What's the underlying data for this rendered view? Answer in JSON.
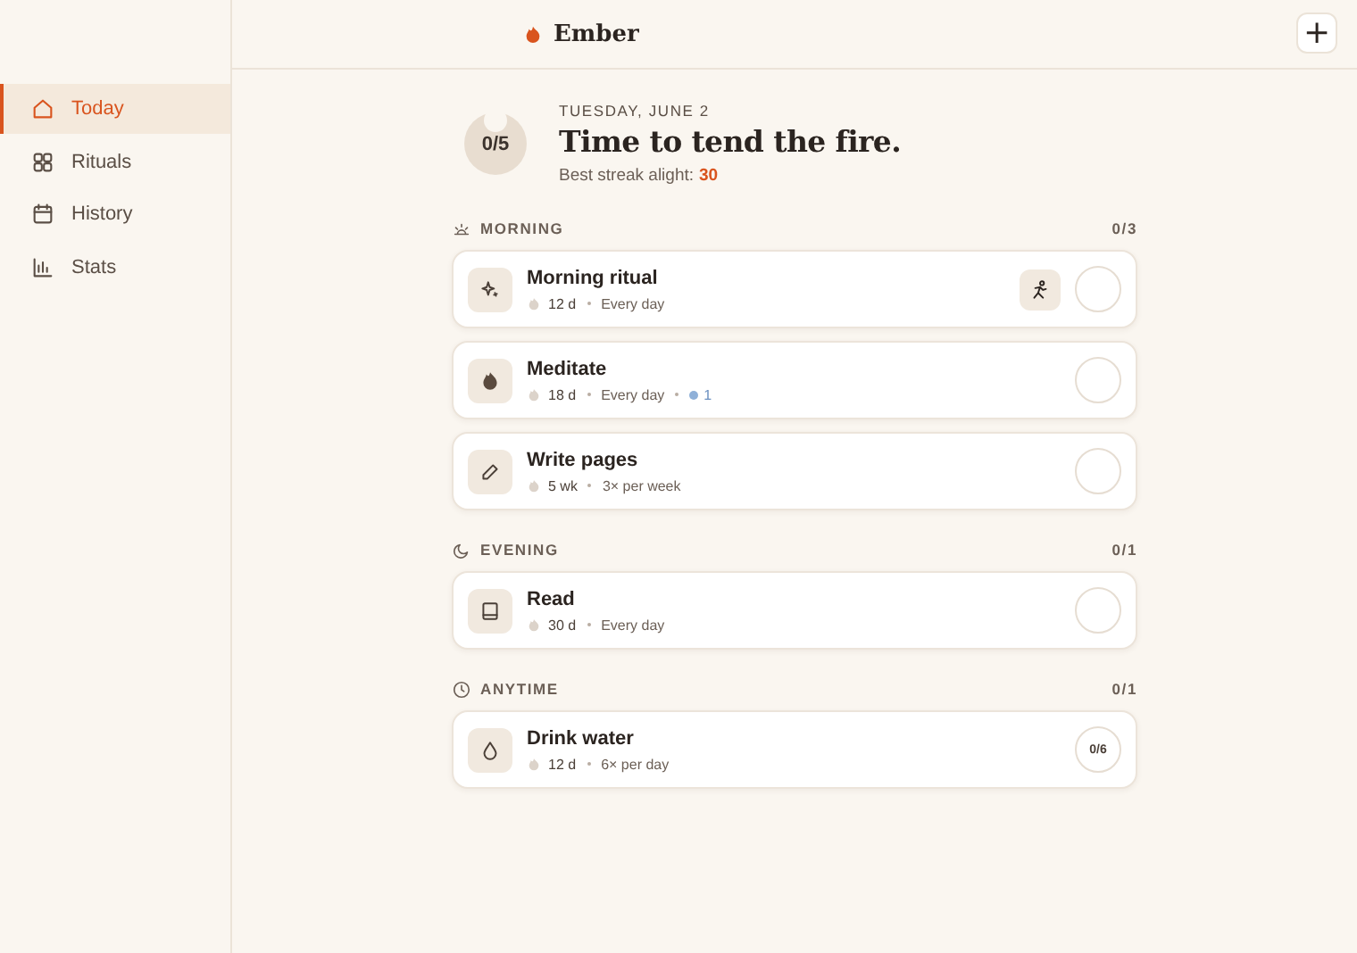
{
  "sidebar": {
    "items": [
      {
        "label": "Today",
        "selected": true
      },
      {
        "label": "Rituals",
        "selected": false
      },
      {
        "label": "History",
        "selected": false
      },
      {
        "label": "Stats",
        "selected": false
      }
    ]
  },
  "header": {
    "app_name": "Ember",
    "add_button": "+"
  },
  "hero": {
    "progress": "0/5",
    "date": "TUESDAY, JUNE 2",
    "headline": "Time to tend the fire.",
    "streak_label": "Best streak alight:",
    "streak_value": "30"
  },
  "sections": [
    {
      "title": "MORNING",
      "count": "0/3",
      "items": [
        {
          "name": "Morning ritual",
          "streak": "12 d",
          "schedule": "Every day",
          "has_action": true,
          "kind": "check",
          "done": false
        },
        {
          "name": "Meditate",
          "streak": "18 d",
          "schedule": "Every day",
          "freeze": "1",
          "kind": "check",
          "done": false
        },
        {
          "name": "Write pages",
          "streak": "5 wk",
          "schedule": "3× per week",
          "kind": "check",
          "done": false
        }
      ]
    },
    {
      "title": "EVENING",
      "count": "0/1",
      "items": [
        {
          "name": "Read",
          "streak": "30 d",
          "schedule": "Every day",
          "kind": "check",
          "done": false
        }
      ]
    },
    {
      "title": "ANYTIME",
      "count": "0/1",
      "items": [
        {
          "name": "Drink water",
          "streak": "12 d",
          "schedule": "6× per day",
          "kind": "counter",
          "counter": "0/6"
        }
      ]
    }
  ]
}
